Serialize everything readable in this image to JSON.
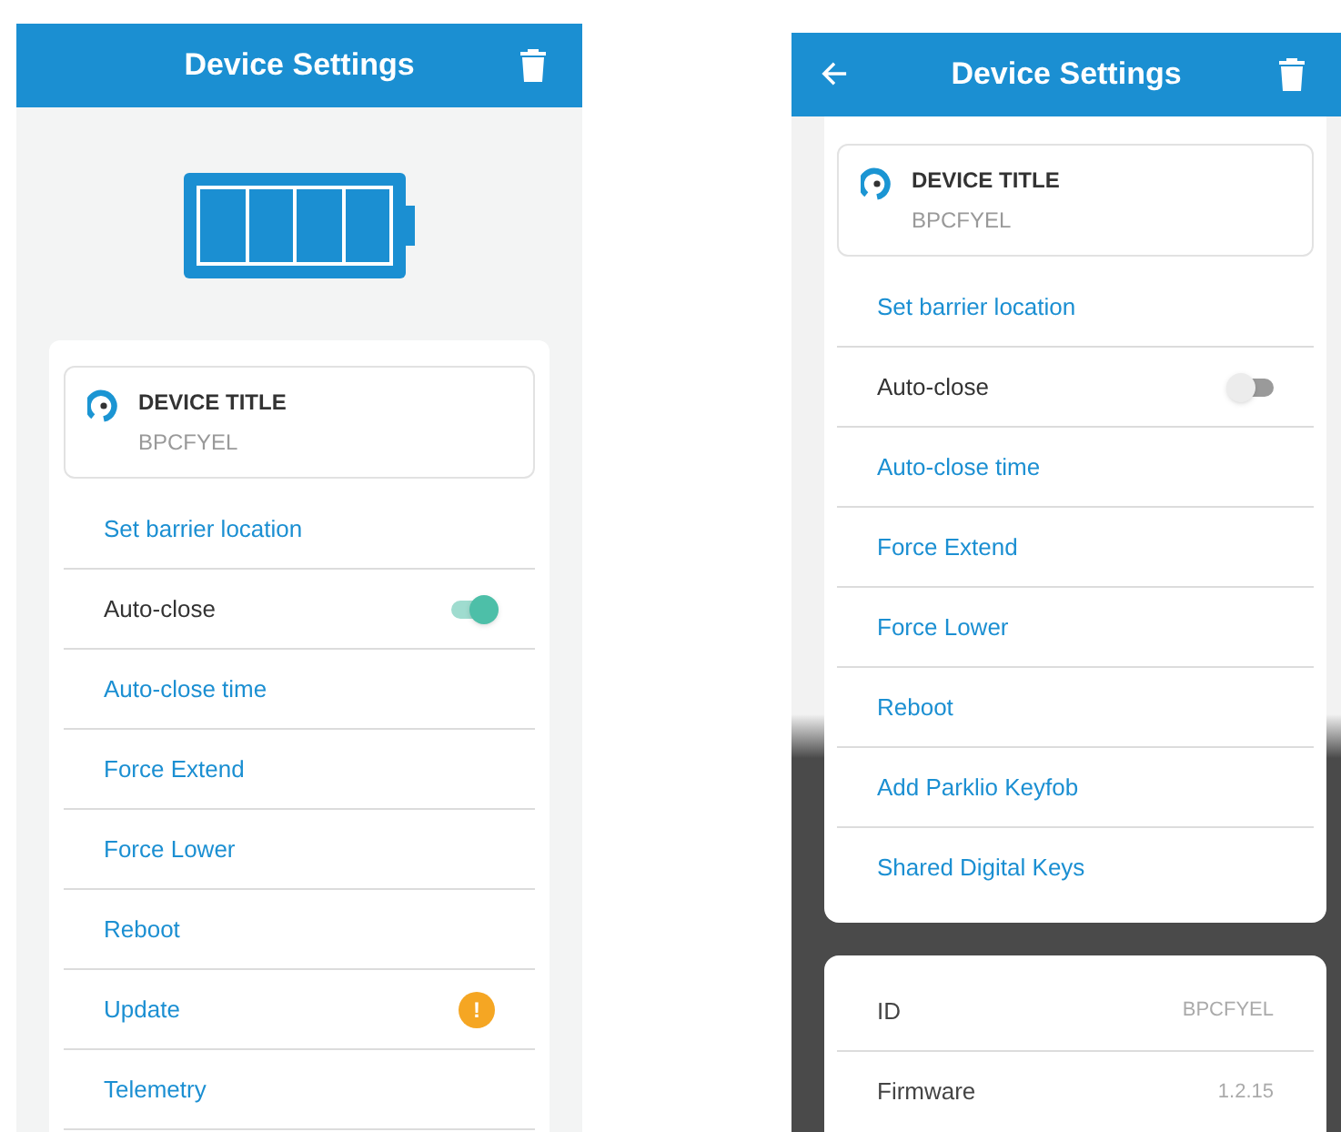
{
  "screens": [
    {
      "title": "Device Settings",
      "back": false,
      "battery": {
        "level": 1
      },
      "device": {
        "title": "DEVICE TITLE",
        "subtitle": "BPCFYEL"
      },
      "items": [
        {
          "kind": "link",
          "label": "Set barrier location"
        },
        {
          "kind": "toggle",
          "label": "Auto-close",
          "on": true
        },
        {
          "kind": "link",
          "label": "Auto-close time"
        },
        {
          "kind": "link",
          "label": "Force Extend"
        },
        {
          "kind": "link",
          "label": "Force Lower"
        },
        {
          "kind": "link",
          "label": "Reboot"
        },
        {
          "kind": "alert",
          "label": "Update",
          "badge": "!"
        },
        {
          "kind": "link",
          "label": "Telemetry"
        }
      ]
    },
    {
      "title": "Device Settings",
      "back": true,
      "device": {
        "title": "DEVICE TITLE",
        "subtitle": "BPCFYEL"
      },
      "items": [
        {
          "kind": "link",
          "label": "Set barrier location"
        },
        {
          "kind": "toggle",
          "label": "Auto-close",
          "on": false
        },
        {
          "kind": "link",
          "label": "Auto-close time"
        },
        {
          "kind": "link",
          "label": "Force Extend"
        },
        {
          "kind": "link",
          "label": "Force Lower"
        },
        {
          "kind": "link",
          "label": "Reboot"
        },
        {
          "kind": "link",
          "label": "Add Parklio Keyfob"
        },
        {
          "kind": "link",
          "label": "Shared Digital Keys"
        }
      ],
      "info": [
        {
          "label": "ID",
          "value": "BPCFYEL"
        },
        {
          "label": "Firmware",
          "value": "1.2.15"
        }
      ]
    }
  ]
}
